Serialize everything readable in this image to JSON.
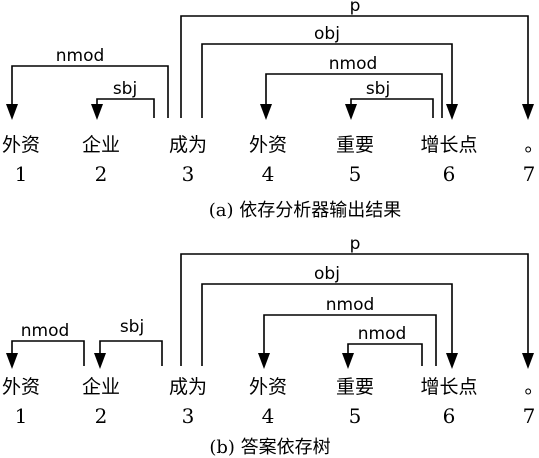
{
  "diagrams": [
    {
      "id": "a",
      "caption": "(a) 依存分析器输出结果",
      "tokens": [
        {
          "word": "外资",
          "index": "1"
        },
        {
          "word": "企业",
          "index": "2"
        },
        {
          "word": "成为",
          "index": "3"
        },
        {
          "word": "外资",
          "index": "4"
        },
        {
          "word": "重要",
          "index": "5"
        },
        {
          "word": "增长点",
          "index": "6"
        },
        {
          "word": "。",
          "index": "7"
        }
      ],
      "arcs": [
        {
          "label": "p",
          "head": 3,
          "dependent": 7
        },
        {
          "label": "obj",
          "head": 3,
          "dependent": 6
        },
        {
          "label": "nmod",
          "head": 6,
          "dependent": 4
        },
        {
          "label": "sbj",
          "head": 6,
          "dependent": 5
        },
        {
          "label": "nmod",
          "head": 3,
          "dependent": 1
        },
        {
          "label": "sbj",
          "head": 3,
          "dependent": 2
        }
      ]
    },
    {
      "id": "b",
      "caption": "(b) 答案依存树",
      "tokens": [
        {
          "word": "外资",
          "index": "1"
        },
        {
          "word": "企业",
          "index": "2"
        },
        {
          "word": "成为",
          "index": "3"
        },
        {
          "word": "外资",
          "index": "4"
        },
        {
          "word": "重要",
          "index": "5"
        },
        {
          "word": "增长点",
          "index": "6"
        },
        {
          "word": "。",
          "index": "7"
        }
      ],
      "arcs": [
        {
          "label": "p",
          "head": 3,
          "dependent": 7
        },
        {
          "label": "obj",
          "head": 3,
          "dependent": 6
        },
        {
          "label": "nmod",
          "head": 6,
          "dependent": 4
        },
        {
          "label": "nmod",
          "head": 6,
          "dependent": 5
        },
        {
          "label": "nmod",
          "head": 2,
          "dependent": 1
        },
        {
          "label": "sbj",
          "head": 3,
          "dependent": 2
        }
      ]
    }
  ]
}
